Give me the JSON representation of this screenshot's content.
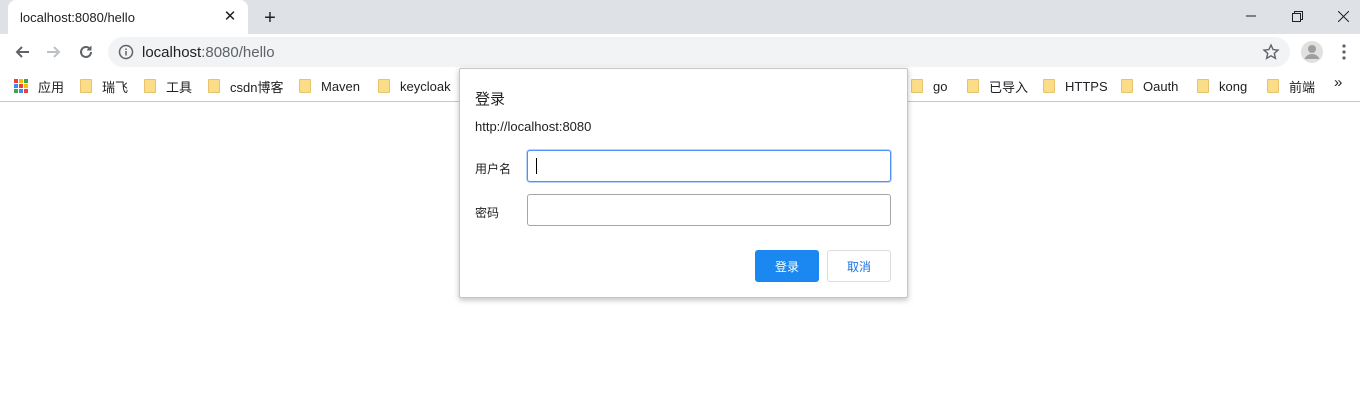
{
  "tab": {
    "title": "localhost:8080/hello",
    "close_icon": "close-icon"
  },
  "omnibox": {
    "host": "localhost",
    "path": ":8080/hello"
  },
  "bookmarks": {
    "apps_label": "应用",
    "folders": [
      "瑞飞",
      "工具",
      "csdn博客",
      "Maven",
      "keycloak",
      "go",
      "已导入",
      "HTTPS",
      "Oauth",
      "kong",
      "前端"
    ],
    "more": "»"
  },
  "dialog": {
    "title": "登录",
    "origin": "http://localhost:8080",
    "username_label": "用户名",
    "username_value": "",
    "password_label": "密码",
    "password_value": "",
    "ok_label": "登录",
    "cancel_label": "取消"
  },
  "colors": {
    "accent": "#1a88f0",
    "folder": "#fbdd87",
    "tabstrip": "#dee1e6"
  }
}
